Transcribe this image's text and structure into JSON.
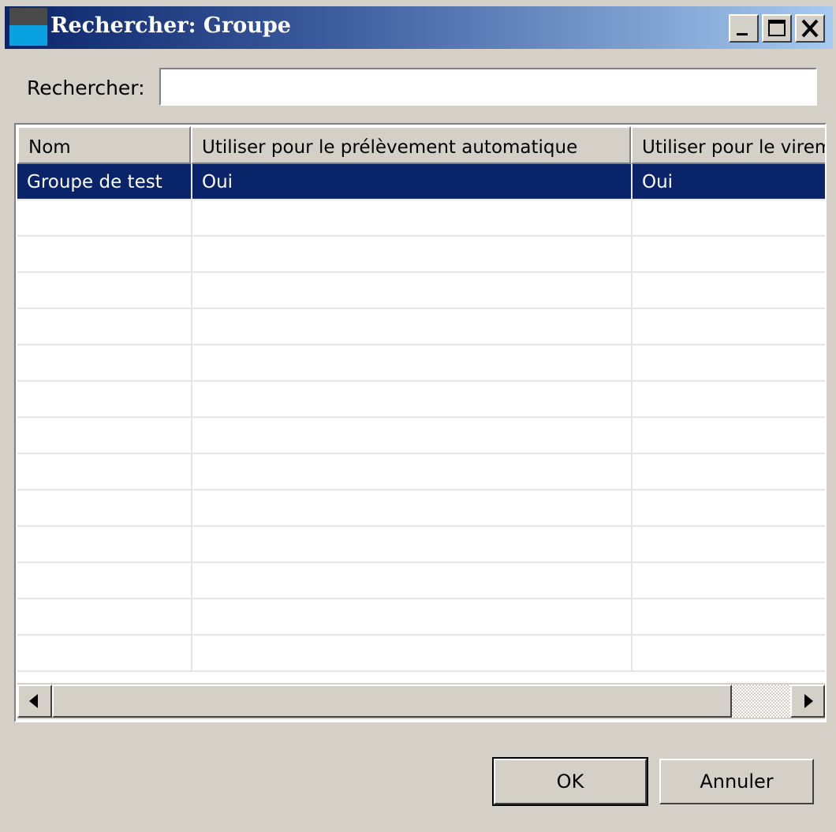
{
  "window": {
    "title": "Rechercher: Groupe",
    "controls": {
      "minimize": "minimize",
      "maximize": "maximize",
      "close": "close"
    }
  },
  "search": {
    "label": "Rechercher:",
    "value": "",
    "placeholder": ""
  },
  "table": {
    "columns": [
      "Nom",
      "Utiliser pour le prélèvement automatique",
      "Utiliser pour le virement"
    ],
    "rows": [
      {
        "nom": "Groupe de test",
        "prelevement": "Oui",
        "virement": "Oui",
        "selected": true
      }
    ],
    "empty_rows": 13
  },
  "buttons": {
    "ok": "OK",
    "cancel": "Annuler"
  },
  "colors": {
    "selection": "#0a246a",
    "titlebar_start": "#0a246a",
    "titlebar_end": "#a6caf0",
    "face": "#d4d0c8"
  },
  "icons": [
    "app-icon",
    "minimize-icon",
    "maximize-icon",
    "close-icon",
    "arrow-left-icon",
    "arrow-right-icon"
  ]
}
